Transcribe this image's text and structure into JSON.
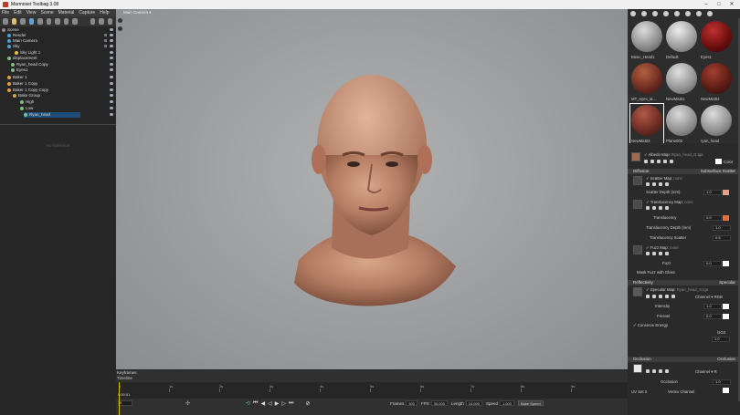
{
  "window": {
    "title": "Marmoset Toolbag 3.08"
  },
  "menu": [
    "File",
    "Edit",
    "View",
    "Scene",
    "Material",
    "Capture",
    "Help"
  ],
  "scene_tree": [
    {
      "label": "Scene",
      "color": "#888888"
    },
    {
      "label": "Render",
      "color": "#4aa3d8"
    },
    {
      "label": "Main Camera",
      "color": "#4aa3d8"
    },
    {
      "label": "Sky",
      "color": "#4aa3d8"
    },
    {
      "label": "Sky Light 1",
      "color": "#e8c040"
    },
    {
      "label": "displacement",
      "color": "#7fbf7f"
    },
    {
      "label": "Ryan_head Copy",
      "color": "#7fbf7f"
    },
    {
      "label": "Eyes1",
      "color": "#7fbf7f"
    },
    {
      "label": "Baker 1",
      "color": "#e0a040"
    },
    {
      "label": "Baker 1 Copy",
      "color": "#e0a040"
    },
    {
      "label": "Baker 1 Copy Copy",
      "color": "#e0a040"
    },
    {
      "label": "Bake Group",
      "color": "#e0a040"
    },
    {
      "label": "High",
      "color": "#7fbf7f"
    },
    {
      "label": "Low",
      "color": "#7fbf7f"
    },
    {
      "label": "Ryan_head",
      "color": "#7fbf7f"
    }
  ],
  "selection_panel": {
    "empty_text": "No Selection"
  },
  "viewport": {
    "camera_label": "Main Camera ▾"
  },
  "timeline": {
    "tab_keyframes": "Keyframes",
    "tab_timeline": "Timeline",
    "ticks": [
      "0",
      "0s",
      "1s",
      "2s",
      "3s",
      "4s",
      "5s",
      "6s",
      "7s",
      "8s",
      "9s"
    ],
    "current_time": "0:00:01",
    "frame": "0",
    "frames_label": "Frames",
    "frames_value": "300",
    "fps_label": "FPS",
    "fps_value": "30.000",
    "length_label": "Length",
    "length_value": "10.000",
    "speed_label": "Speed",
    "speed_value": "1.000",
    "bake_speed": "Bake Speed"
  },
  "materials": [
    {
      "label": "Basic_Head1",
      "color": "#a9a9a9",
      "hi": "#d8d8d8"
    },
    {
      "label": "Default",
      "color": "#b8b8b8",
      "hi": "#e6e6e6"
    },
    {
      "label": "Eyes1",
      "color": "#7a1010",
      "hi": "#c03030"
    },
    {
      "label": "MT_eyes_la...",
      "color": "#6b2a20",
      "hi": "#b26040"
    },
    {
      "label": "NewMat01",
      "color": "#a8a8a8",
      "hi": "#dedede"
    },
    {
      "label": "NewMat02",
      "color": "#5a1a14",
      "hi": "#a04030"
    },
    {
      "label": "NewMat03",
      "color": "#6a2a22",
      "hi": "#b05a48"
    },
    {
      "label": "Plane002",
      "color": "#a5a5a5",
      "hi": "#dadada"
    },
    {
      "label": "ryan_head",
      "color": "#a6a6a6",
      "hi": "#dcdcdc"
    }
  ],
  "props": {
    "albedo_map_label": "Albedo Map:",
    "albedo_map_value": "Ryan_head_D.tga",
    "color_label": "Color",
    "diffusion_label": "Diffusion",
    "diffusion_mode": "Subsurface Scatter",
    "scatter_map_label": "Scatter Map:",
    "scatter_map_value": "none",
    "scatter_depth_label": "Scatter Depth (mm)",
    "scatter_depth_value": "1.0",
    "translucency_map_label": "Translucency Map:",
    "translucency_map_value": "none",
    "translucency_label": "Translucency",
    "translucency_value": "0.0",
    "translucency_depth_label": "Translucency Depth (mm)",
    "translucency_depth_value": "1.0",
    "translucency_scatter_label": "Translucency Scatter",
    "translucency_scatter_value": "0.5",
    "fuzz_map_label": "Fuzz Map:",
    "fuzz_map_value": "none",
    "fuzz_label": "Fuzz",
    "fuzz_value": "0.0",
    "mask_fuzz_label": "Mask Fuzz with Gloss",
    "reflectivity_label": "Reflectivity",
    "reflectivity_mode": "Specular",
    "specular_map_label": "Specular Map:",
    "specular_map_value": "Ryan_head_S.tga",
    "channel_label": "Channel ▾",
    "channel_value": "RGB",
    "intensity_label": "Intensity",
    "intensity_value": "1.0",
    "fresnel_label": "Fresnel",
    "fresnel_value": "0.0",
    "conserve_energy_label": "Conserve Energy",
    "occlusion_label": "Occlusion",
    "occlusion_mode": "Occlusion",
    "occlusion_value": "1.0",
    "uv_set_label": "UV Set",
    "uv_set_value": "0",
    "vertex_channel_label": "Vertex Channel",
    "channel2_value": "R",
    "ggx_label": "GGX",
    "ggx_value": "1.0"
  },
  "colors": {
    "accent": "#e07050",
    "selection": "#1e4f7a",
    "playhead": "#e0c000",
    "play_green": "#4ecb4e"
  }
}
